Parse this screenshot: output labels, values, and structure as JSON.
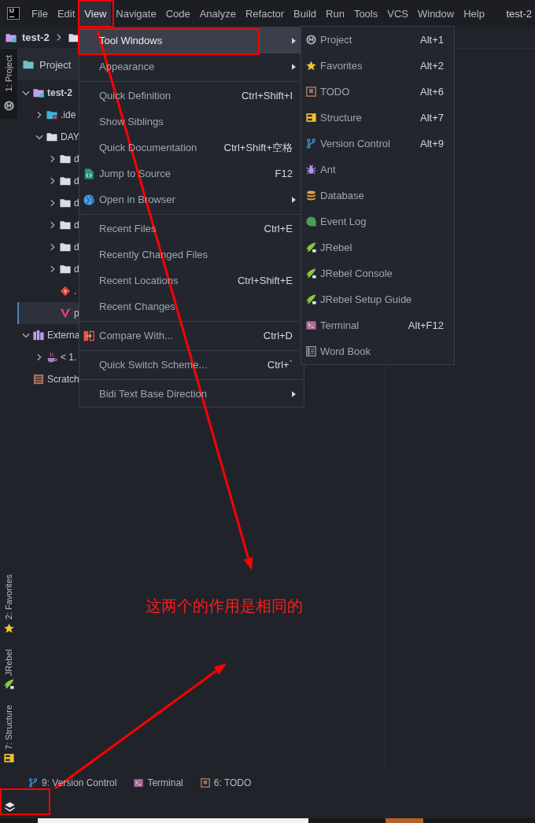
{
  "menubar": {
    "logo": "IJ",
    "items": [
      {
        "label": "File",
        "selected": false
      },
      {
        "label": "Edit",
        "selected": false
      },
      {
        "label": "View",
        "selected": true
      },
      {
        "label": "Navigate",
        "selected": false
      },
      {
        "label": "Code",
        "selected": false
      },
      {
        "label": "Analyze",
        "selected": false
      },
      {
        "label": "Refactor",
        "selected": false
      },
      {
        "label": "Build",
        "selected": false
      },
      {
        "label": "Run",
        "selected": false
      },
      {
        "label": "Tools",
        "selected": false
      },
      {
        "label": "VCS",
        "selected": false
      },
      {
        "label": "Window",
        "selected": false
      },
      {
        "label": "Help",
        "selected": false
      }
    ],
    "title": "test-2"
  },
  "navbar": {
    "crumbs": [
      {
        "label": "test-2",
        "kind": "module"
      },
      {
        "kind": "folder"
      }
    ]
  },
  "project_panel": {
    "title": "Project",
    "tree": [
      {
        "label": "test-2",
        "kind": "module",
        "expanded": true,
        "selected": false,
        "children": [
          {
            "label": ".ide",
            "kind": "idea",
            "expanded": false,
            "selected": false
          },
          {
            "label": "DAY",
            "kind": "folder",
            "expanded": true,
            "selected": false,
            "children": [
              {
                "label": "d",
                "kind": "folder",
                "expanded": false,
                "selected": false
              },
              {
                "label": "d",
                "kind": "folder",
                "expanded": false,
                "selected": false
              },
              {
                "label": "d",
                "kind": "folder",
                "expanded": false,
                "selected": false
              },
              {
                "label": "d",
                "kind": "folder",
                "expanded": false,
                "selected": false
              },
              {
                "label": "d",
                "kind": "folder",
                "expanded": false,
                "selected": false
              },
              {
                "label": "d",
                "kind": "folder",
                "expanded": false,
                "selected": false
              },
              {
                "label": ".",
                "kind": "git",
                "selected": false
              },
              {
                "label": "p",
                "kind": "vue",
                "selected": true
              }
            ]
          }
        ]
      },
      {
        "label": "Externa",
        "kind": "library",
        "expanded": true,
        "selected": false,
        "children": [
          {
            "label": "< 1.",
            "kind": "jdk",
            "expanded": false,
            "selected": false
          }
        ]
      },
      {
        "label": "Scratch",
        "kind": "scratches",
        "selected": false
      }
    ]
  },
  "view_menu": {
    "groups": [
      [
        {
          "label": "Tool Windows",
          "kind": "plain",
          "selected": true,
          "submenu": true
        },
        {
          "label": "Appearance",
          "kind": "plain",
          "selected": false,
          "submenu": true
        }
      ],
      [
        {
          "label": "Quick Definition",
          "shortcut": "Ctrl+Shift+I",
          "kind": "plain",
          "selected": false,
          "submenu": false
        },
        {
          "label": "Show Siblings",
          "kind": "plain",
          "selected": false,
          "submenu": false
        },
        {
          "label": "Quick Documentation",
          "shortcut": "Ctrl+Shift+空格",
          "kind": "plain",
          "selected": false,
          "submenu": false
        },
        {
          "label": "Jump to Source",
          "shortcut": "F12",
          "kind": "source",
          "selected": false,
          "submenu": false
        },
        {
          "label": "Open in Browser",
          "kind": "browser",
          "selected": false,
          "submenu": true
        }
      ],
      [
        {
          "label": "Recent Files",
          "shortcut": "Ctrl+E",
          "kind": "plain",
          "selected": false,
          "submenu": false
        },
        {
          "label": "Recently Changed Files",
          "kind": "plain",
          "selected": false,
          "submenu": false
        },
        {
          "label": "Recent Locations",
          "shortcut": "Ctrl+Shift+E",
          "kind": "plain",
          "selected": false,
          "submenu": false
        },
        {
          "label": "Recent Changes",
          "kind": "plain",
          "selected": false,
          "submenu": false
        }
      ],
      [
        {
          "label": "Compare With...",
          "shortcut": "Ctrl+D",
          "kind": "compare",
          "selected": false,
          "submenu": false
        }
      ],
      [
        {
          "label": "Quick Switch Scheme...",
          "shortcut": "Ctrl+`",
          "kind": "plain",
          "selected": false,
          "submenu": false
        }
      ],
      [
        {
          "label": "Bidi Text Base Direction",
          "kind": "plain",
          "selected": false,
          "submenu": true
        }
      ]
    ]
  },
  "tool_windows_menu": {
    "items": [
      {
        "label": "Project",
        "shortcut": "Alt+1",
        "kind": "project",
        "selected": false
      },
      {
        "label": "Favorites",
        "shortcut": "Alt+2",
        "kind": "favorites",
        "selected": false
      },
      {
        "label": "TODO",
        "shortcut": "Alt+6",
        "kind": "todo",
        "selected": false
      },
      {
        "label": "Structure",
        "shortcut": "Alt+7",
        "kind": "structure",
        "selected": false
      },
      {
        "label": "Version Control",
        "shortcut": "Alt+9",
        "kind": "vcs",
        "selected": false
      },
      {
        "label": "Ant",
        "kind": "ant",
        "selected": false
      },
      {
        "label": "Database",
        "kind": "database",
        "selected": false
      },
      {
        "label": "Event Log",
        "kind": "eventlog",
        "selected": false
      },
      {
        "label": "JRebel",
        "kind": "jrebel",
        "selected": false
      },
      {
        "label": "JRebel Console",
        "kind": "jrebel",
        "selected": false
      },
      {
        "label": "JRebel Setup Guide",
        "kind": "jrebel",
        "selected": false
      },
      {
        "label": "Terminal",
        "shortcut": "Alt+F12",
        "kind": "terminal",
        "selected": false
      },
      {
        "label": "Word Book",
        "kind": "wordbook",
        "selected": false
      }
    ]
  },
  "left_stripe": {
    "top": [
      {
        "label": "1: Project",
        "kind": "project",
        "selected": true
      }
    ],
    "bottom": [
      {
        "label": "2: Favorites",
        "kind": "favorites",
        "selected": false
      },
      {
        "label": "JRebel",
        "kind": "jrebel",
        "selected": false
      },
      {
        "label": "7: Structure",
        "kind": "structure",
        "selected": false
      }
    ]
  },
  "bottom_bar": {
    "tabs": [
      {
        "label": "9: Version Control",
        "kind": "vcs",
        "selected": false
      },
      {
        "label": "Terminal",
        "kind": "terminal",
        "selected": false
      },
      {
        "label": "6: TODO",
        "kind": "todo",
        "selected": false
      }
    ]
  },
  "annotation": {
    "note": "这两个的作用是相同的"
  }
}
